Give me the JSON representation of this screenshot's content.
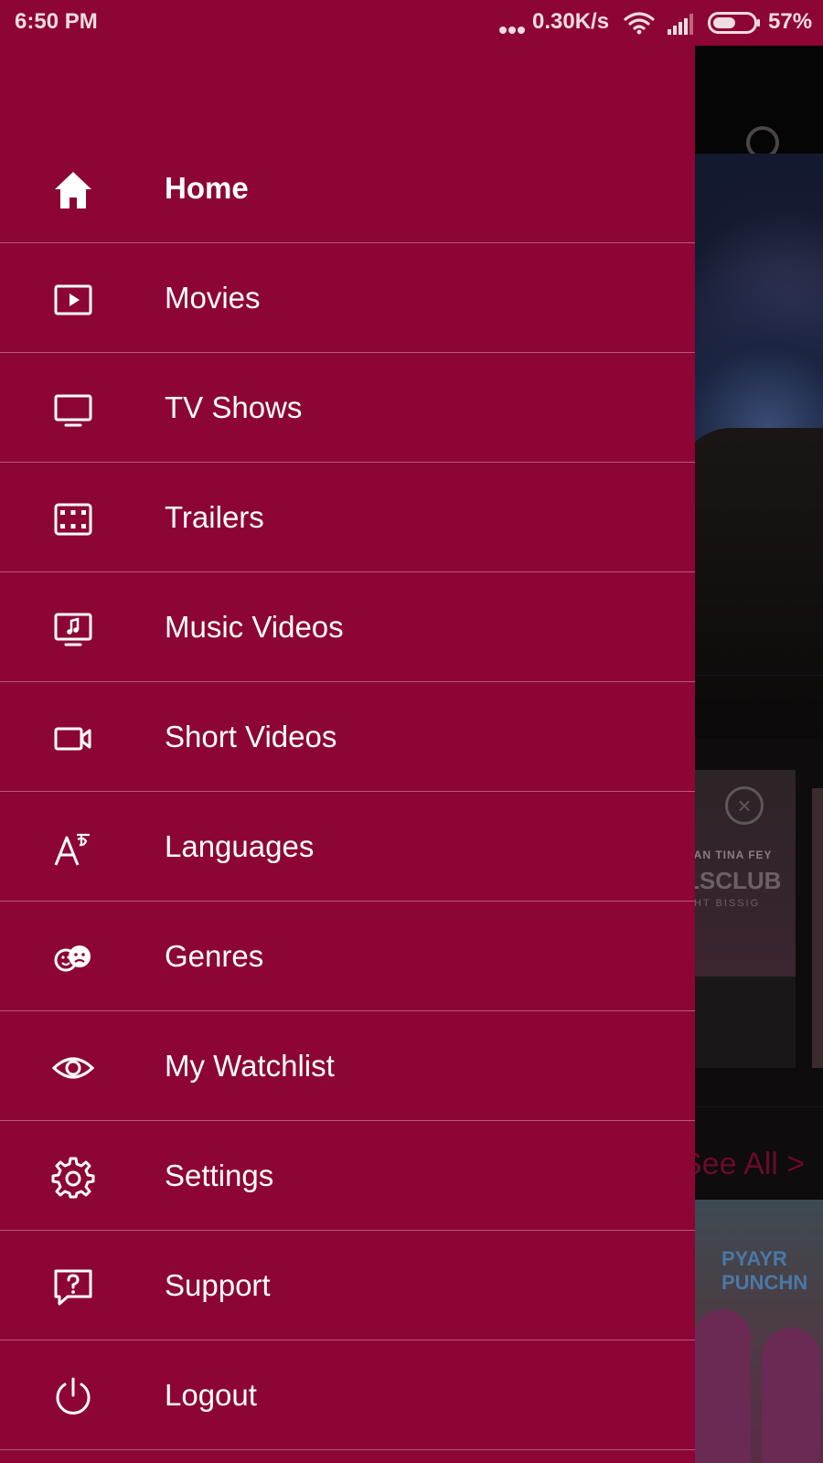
{
  "status_bar": {
    "time": "6:50 PM",
    "network_speed": "0.30K/s",
    "battery_percent": "57%",
    "battery_level": 0.57
  },
  "background": {
    "card_text_top": "HAN  TINA FEY",
    "card_text_main": "LSCLUB",
    "card_text_sub": "CHT BISSIG",
    "see_all_label": "See All >",
    "poster_title_line1": "PYAYR",
    "poster_title_line2": "PUNCHN"
  },
  "drawer": {
    "items": [
      {
        "label": "Home",
        "icon": "home-icon",
        "active": true
      },
      {
        "label": "Movies",
        "icon": "play-box-icon"
      },
      {
        "label": "TV Shows",
        "icon": "tv-icon"
      },
      {
        "label": "Trailers",
        "icon": "film-strip-icon"
      },
      {
        "label": "Music Videos",
        "icon": "music-monitor-icon"
      },
      {
        "label": "Short Videos",
        "icon": "video-camera-icon"
      },
      {
        "label": "Languages",
        "icon": "language-icon"
      },
      {
        "label": "Genres",
        "icon": "theater-masks-icon"
      },
      {
        "label": "My Watchlist",
        "icon": "eye-icon"
      },
      {
        "label": "Settings",
        "icon": "gear-icon"
      },
      {
        "label": "Support",
        "icon": "question-bubble-icon"
      },
      {
        "label": "Logout",
        "icon": "power-icon"
      }
    ]
  },
  "colors": {
    "drawer_background": "#8c0534",
    "divider": "#b35a79",
    "text": "#ffffff"
  }
}
